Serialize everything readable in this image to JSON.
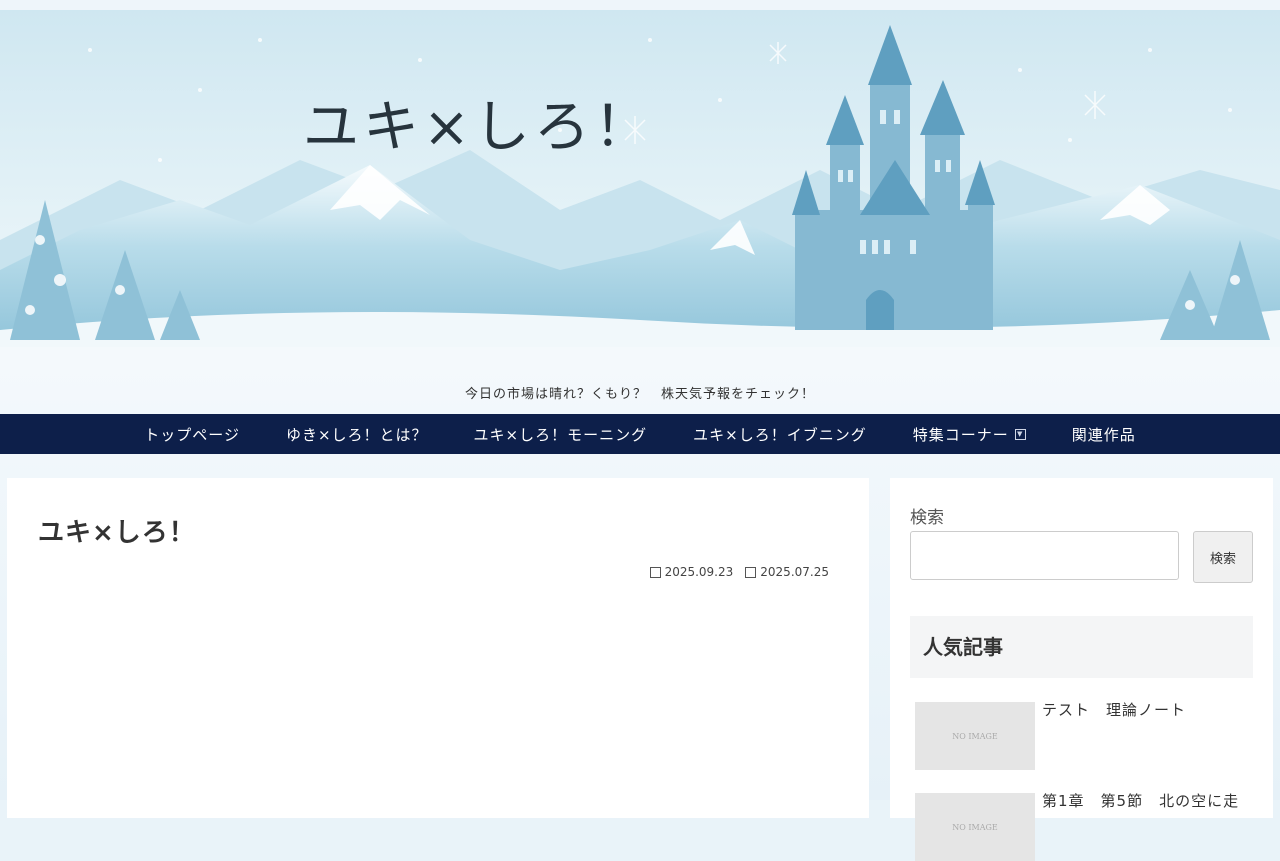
{
  "site": {
    "logo": "ユキ×しろ！",
    "tagline": "今日の市場は晴れ？くもり？　株天気予報をチェック！"
  },
  "nav": {
    "items": [
      {
        "label": "トップページ"
      },
      {
        "label": "ゆき×しろ！とは？"
      },
      {
        "label": "ユキ×しろ！モーニング"
      },
      {
        "label": "ユキ×しろ！イブニング"
      },
      {
        "label": "特集コーナー",
        "has_submenu": true
      },
      {
        "label": "関連作品"
      }
    ]
  },
  "post": {
    "title": "ユキ×しろ！",
    "published": "2025.09.23",
    "updated": "2025.07.25"
  },
  "sidebar": {
    "search_label": "検索",
    "search_button": "検索",
    "search_placeholder": "",
    "popular_heading": "人気記事",
    "popular": [
      {
        "title": "テスト　理論ノート",
        "thumb_text": "NO IMAGE"
      },
      {
        "title": "第1章　第5節　北の空に走",
        "thumb_text": "NO IMAGE"
      }
    ]
  },
  "colors": {
    "nav_bg": "#0d1f4a",
    "banner_sky": "#d6ebf3",
    "mountain": "#a9d3e4",
    "castle": "#7fb4cf"
  },
  "icons": {
    "dropdown": "chevron-down-icon",
    "published": "clock-icon",
    "updated": "refresh-icon"
  }
}
